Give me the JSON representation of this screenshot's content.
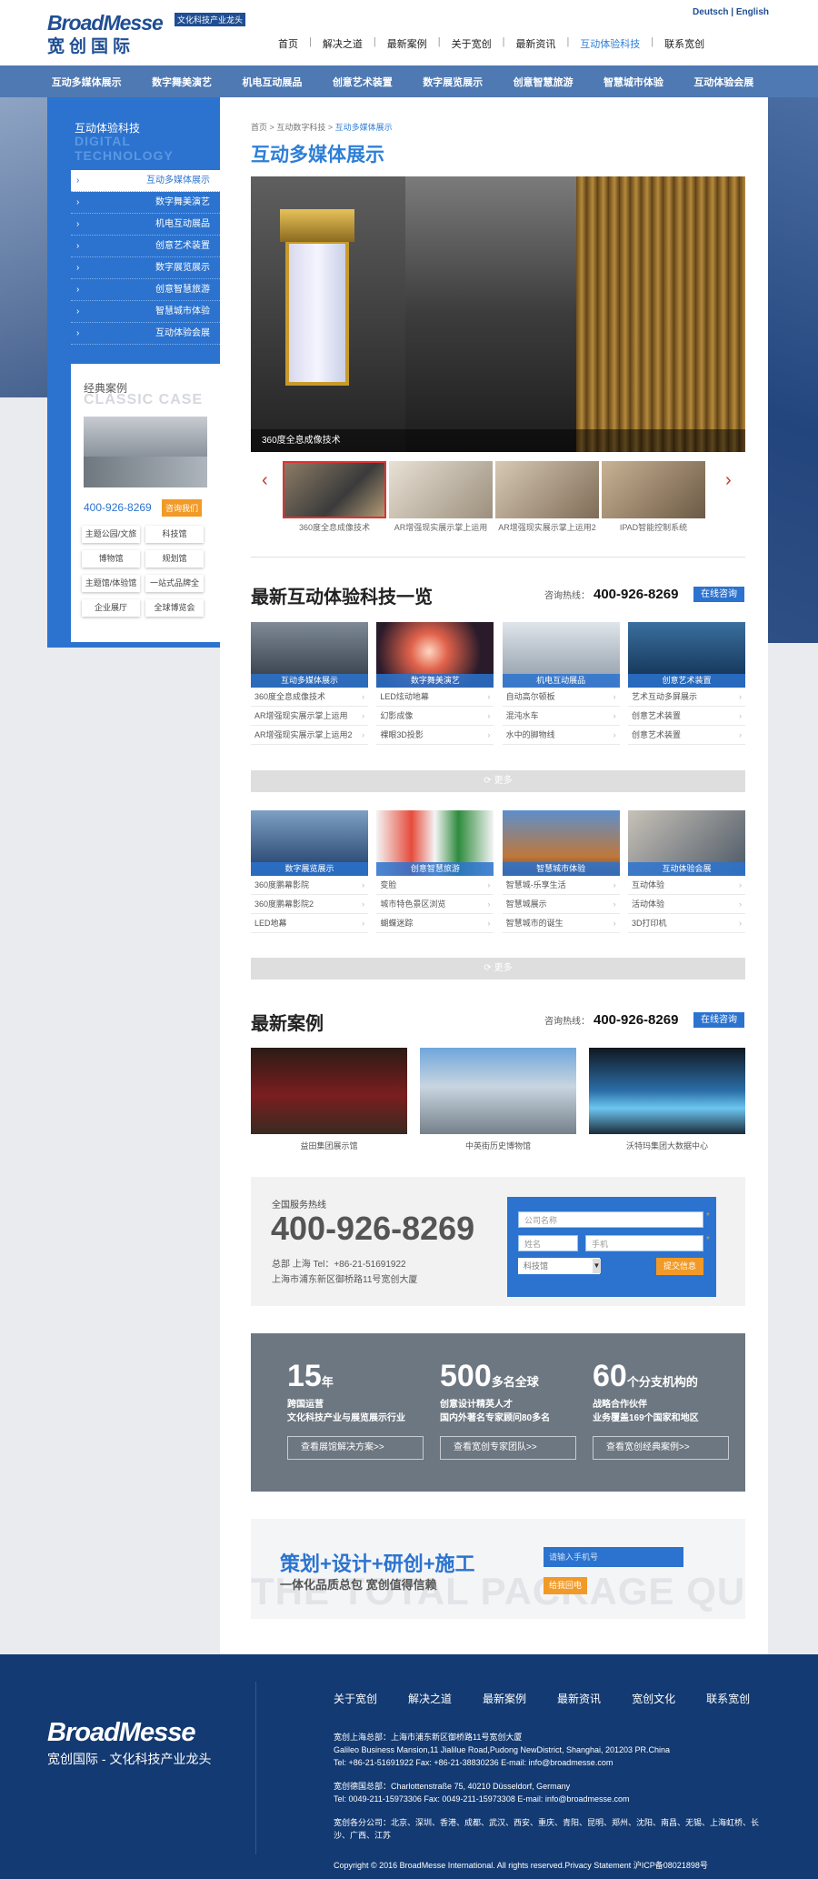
{
  "header": {
    "logo_en": "BroadMesse",
    "logo_cn": "宽创国际",
    "logo_tag": "文化科技产业龙头",
    "lang_de": "Deutsch",
    "lang_sep": "|",
    "lang_en": "English",
    "nav": [
      "首页",
      "解决之道",
      "最新案例",
      "关于宽创",
      "最新资讯",
      "互动体验科技",
      "联系宽创"
    ],
    "nav_sep": "|"
  },
  "catbar": [
    "互动多媒体展示",
    "数字舞美演艺",
    "机电互动展品",
    "创意艺术装置",
    "数字展览展示",
    "创意智慧旅游",
    "智慧城市体验",
    "互动体验会展"
  ],
  "sidebar": {
    "title": "互动体验科技",
    "title_en": "DIGITAL TECHNOLOGY",
    "items": [
      "互动多媒体展示",
      "数字舞美演艺",
      "机电互动展品",
      "创意艺术装置",
      "数字展览展示",
      "创意智慧旅游",
      "智慧城市体验",
      "互动体验会展"
    ],
    "case_title": "经典案例",
    "case_title_en": "CLASSIC CASE",
    "phone": "400-926-8269",
    "consult_btn": "咨询我们",
    "tags": [
      "主题公园/文旅",
      "科技馆",
      "博物馆",
      "规划馆",
      "主题馆/体验馆",
      "一站式品牌全",
      "企业展厅",
      "全球博览会"
    ]
  },
  "breadcrumb": {
    "home": "首页",
    "sep": ">",
    "level2": "互动数字科技",
    "current": "互动多媒体展示"
  },
  "page_title": "互动多媒体展示",
  "hero": {
    "caption": "360度全息成像技术",
    "prev": "‹",
    "next": "›",
    "thumbs": [
      "360度全息成像技术",
      "AR增强现实展示掌上运用",
      "AR增强现实展示掌上运用2",
      "IPAD智能控制系统"
    ]
  },
  "section1": {
    "title": "最新互动体验科技一览",
    "hotline_label": "咨询热线：",
    "hotline": "400-926-8269",
    "consult": "在线咨询",
    "more": "更多",
    "row1": [
      {
        "label": "互动多媒体展示",
        "items": [
          "360度全息成像技术",
          "AR增强现实展示掌上运用",
          "AR增强现实展示掌上运用2"
        ]
      },
      {
        "label": "数字舞美演艺",
        "items": [
          "LED炫动地幕",
          "幻影成像",
          "裸眼3D投影"
        ]
      },
      {
        "label": "机电互动展品",
        "items": [
          "自动高尔顿板",
          "混沌水车",
          "水中的脚物线"
        ]
      },
      {
        "label": "创意艺术装置",
        "items": [
          "艺术互动多屏展示",
          "创意艺术装置",
          "创意艺术装置"
        ]
      }
    ],
    "row2": [
      {
        "label": "数字展览展示",
        "items": [
          "360度鹏幕影院",
          "360度鹏幕影院2",
          "LED地幕"
        ]
      },
      {
        "label": "创意智慧旅游",
        "items": [
          "变脸",
          "城市特色景区浏览",
          "蝴蝶迷踪"
        ]
      },
      {
        "label": "智慧城市体验",
        "items": [
          "智慧城-乐享生活",
          "智慧城展示",
          "智慧城市的诞生"
        ]
      },
      {
        "label": "互动体验会展",
        "items": [
          "互动体验",
          "活动体验",
          "3D打印机"
        ]
      }
    ]
  },
  "section2": {
    "title": "最新案例",
    "hotline_label": "咨询热线：",
    "hotline": "400-926-8269",
    "consult": "在线咨询",
    "cases": [
      "益田集团展示馆",
      "中英街历史博物馆",
      "沃特玛集团大数据中心"
    ]
  },
  "service": {
    "label": "全国服务热线",
    "phone": "400-926-8269",
    "addr1": "总部 上海 Tel：+86-21-51691922",
    "addr2": "上海市浦东新区御桥路11号宽创大厦",
    "form": {
      "company": "公司名称",
      "name": "姓名",
      "mobile": "手机",
      "select": "科技馆",
      "submit": "提交信息",
      "star": "*"
    }
  },
  "stats": [
    {
      "num": "15",
      "unit": "年",
      "d1": "跨国运营",
      "d2": "文化科技产业与展览展示行业",
      "btn": "查看展馆解决方案>>"
    },
    {
      "num": "500",
      "unit": "多名全球",
      "d1": "创意设计精英人才",
      "d2": "国内外著名专家顾问80多名",
      "btn": "查看宽创专家团队>>"
    },
    {
      "num": "60",
      "unit": "个分支机构的",
      "d1": "战略合作伙伴",
      "d2": "业务覆盖169个国家和地区",
      "btn": "查看宽创经典案例>>"
    }
  ],
  "plan": {
    "title": "策划+设计+研创+施工",
    "sub": "一体化品质总包 宽创值得信赖",
    "ghost": "THE TOTAL PACKAGE QUALITY",
    "input_placeholder": "请输入手机号",
    "btn": "给我回电"
  },
  "footer": {
    "logo_en": "BroadMesse",
    "logo_cn": "宽创国际 - 文化科技产业龙头",
    "nav": [
      "关于宽创",
      "解决之道",
      "最新案例",
      "最新资讯",
      "宽创文化",
      "联系宽创"
    ],
    "sh1": "宽创上海总部：上海市浦东新区御桥路11号宽创大厦",
    "sh2": "Galileo Business Mansion,11 Jialilue Road,Pudong NewDistrict, Shanghai, 201203 PR.China",
    "sh3": "Tel: +86-21-51691922   Fax: +86-21-38830236   E-mail: info@broadmesse.com",
    "de1": "宽创德国总部：Charlottenstraße 75, 40210 Düsseldorf, Germany",
    "de2": "Tel: 0049-211-15973306 Fax: 0049-211-15973308 E-mail: info@broadmesse.com",
    "br": "宽创各分公司：北京、深圳、香港、成都、武汉、西安、重庆、青阳、昆明、郑州、沈阳、南昌、无锡、上海虹桥、长沙、广西、江苏",
    "copyright": "Copyright © 2016 BroadMesse International. All rights reserved.Privacy Statement  沪ICP备08021898号"
  }
}
